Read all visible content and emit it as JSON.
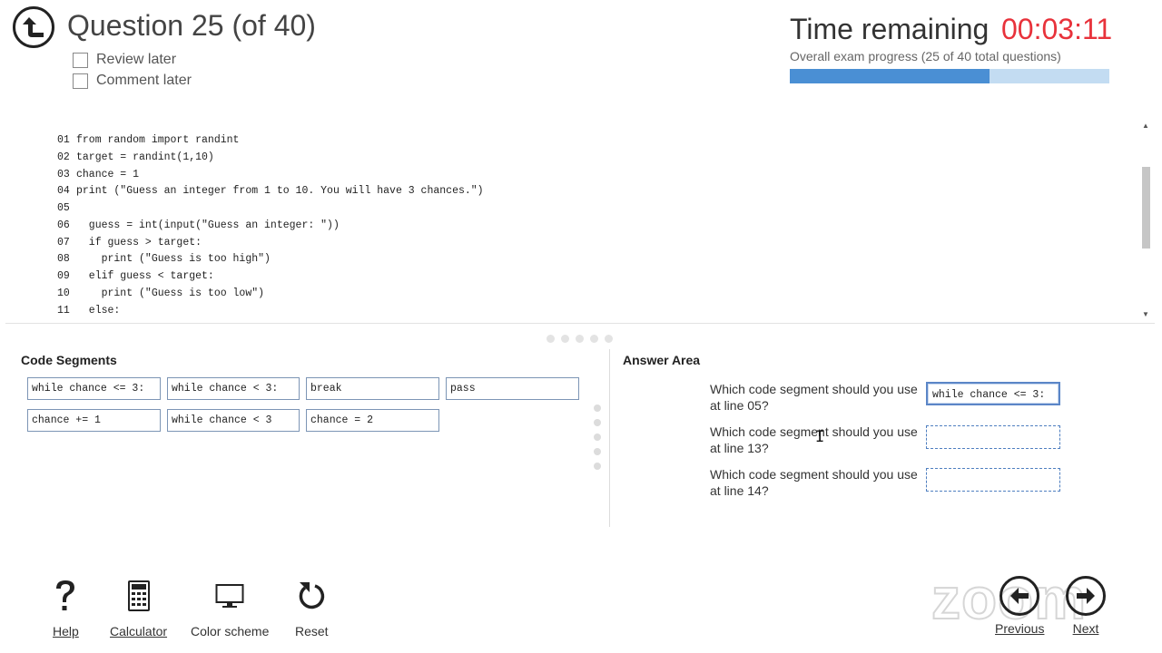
{
  "header": {
    "question_title": "Question 25 (of 40)",
    "review_later_label": "Review later",
    "comment_later_label": "Comment later"
  },
  "timer": {
    "label": "Time remaining",
    "value": "00:03:11",
    "value_color": "#e8323b"
  },
  "progress": {
    "text": "Overall exam progress (25 of 40 total questions)",
    "fraction": 0.625,
    "fill_color": "#4a8fd4",
    "track_color": "#c3dcf2"
  },
  "code": {
    "lines": [
      {
        "num": "01",
        "text": "from random import randint"
      },
      {
        "num": "02",
        "text": "target = randint(1,10)"
      },
      {
        "num": "03",
        "text": "chance = 1"
      },
      {
        "num": "04",
        "text": "print (\"Guess an integer from 1 to 10. You will have 3 chances.\")"
      },
      {
        "num": "05",
        "text": ""
      },
      {
        "num": "06",
        "text": "  guess = int(input(\"Guess an integer: \"))"
      },
      {
        "num": "07",
        "text": "  if guess > target:"
      },
      {
        "num": "08",
        "text": "    print (\"Guess is too high\")"
      },
      {
        "num": "09",
        "text": "  elif guess < target:"
      },
      {
        "num": "10",
        "text": "    print (\"Guess is too low\")"
      },
      {
        "num": "11",
        "text": "  else:"
      }
    ]
  },
  "segments": {
    "heading": "Code Segments",
    "items": [
      "while chance <= 3:",
      "while chance < 3:",
      "break",
      "pass",
      "chance += 1",
      "while chance < 3",
      "chance = 2"
    ]
  },
  "answers": {
    "heading": "Answer Area",
    "questions": [
      {
        "text": "Which code segment should you use at line 05?",
        "value": "while chance <= 3:"
      },
      {
        "text": "Which code segment should you use at line 13?",
        "value": ""
      },
      {
        "text": "Which code segment should you use at line 14?",
        "value": ""
      }
    ]
  },
  "toolbar": {
    "help_label": "Help",
    "calculator_label": "Calculator",
    "color_scheme_label": "Color scheme",
    "reset_label": "Reset",
    "previous_label": "Previous",
    "next_label": "Next"
  },
  "watermark": "zoom",
  "icons": [
    "back-arrow-icon",
    "help-icon",
    "calculator-icon",
    "monitor-icon",
    "reset-icon",
    "previous-icon",
    "next-icon"
  ]
}
